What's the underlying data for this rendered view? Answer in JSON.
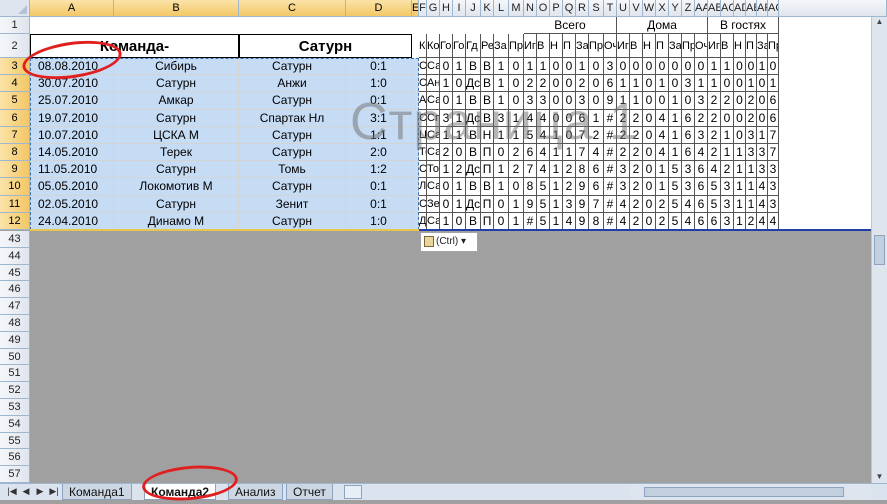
{
  "columns": [
    "A",
    "B",
    "C",
    "D",
    "E",
    "F",
    "G",
    "H",
    "I",
    "J",
    "K",
    "L",
    "M",
    "N",
    "O",
    "P",
    "Q",
    "R",
    "S",
    "T",
    "U",
    "V",
    "W",
    "X",
    "Y",
    "Z",
    "AA",
    "AB",
    "AC",
    "AD",
    "AE",
    "AF",
    "AG",
    "AH"
  ],
  "left_header": {
    "row_num": "2",
    "team_label": "Команда-",
    "team_value": "Сатурн"
  },
  "right_header": {
    "group_all": "Всего",
    "group_home": "Дома",
    "group_away": "В гостях",
    "sub": [
      "Ко",
      "Ко",
      "Го",
      "Го",
      "Гд",
      "Ре",
      "За",
      "Пр",
      "Иг",
      "В",
      "Н",
      "П",
      "За",
      "Пр",
      "Оч",
      "Иг",
      "В",
      "Н",
      "П",
      "За",
      "Пр",
      "Оч",
      "Иг",
      "В",
      "Н",
      "П",
      "За",
      "Пр"
    ]
  },
  "rows": [
    {
      "n": "3",
      "date": "08.08.2010",
      "home": "Сибирь",
      "away": "Сатурн",
      "score": "0:1"
    },
    {
      "n": "4",
      "date": "30.07.2010",
      "home": "Сатурн",
      "away": "Анжи",
      "score": "1:0"
    },
    {
      "n": "5",
      "date": "25.07.2010",
      "home": "Амкар",
      "away": "Сатурн",
      "score": "0:1"
    },
    {
      "n": "6",
      "date": "19.07.2010",
      "home": "Сатурн",
      "away": "Спартак Нл",
      "score": "3:1"
    },
    {
      "n": "7",
      "date": "10.07.2010",
      "home": "ЦСКА М",
      "away": "Сатурн",
      "score": "1:1"
    },
    {
      "n": "8",
      "date": "14.05.2010",
      "home": "Терек",
      "away": "Сатурн",
      "score": "2:0"
    },
    {
      "n": "9",
      "date": "11.05.2010",
      "home": "Сатурн",
      "away": "Томь",
      "score": "1:2"
    },
    {
      "n": "10",
      "date": "05.05.2010",
      "home": "Локомотив М",
      "away": "Сатурн",
      "score": "0:1"
    },
    {
      "n": "11",
      "date": "02.05.2010",
      "home": "Сатурн",
      "away": "Зенит",
      "score": "0:1"
    },
    {
      "n": "12",
      "date": "24.04.2010",
      "home": "Динамо М",
      "away": "Сатурн",
      "score": "1:0"
    }
  ],
  "stats": [
    [
      "Си",
      "Са",
      "0",
      "1",
      "В",
      "В",
      "1",
      "0",
      "1",
      "1",
      "0",
      "0",
      "1",
      "0",
      "3",
      "0",
      "0",
      "0",
      "0",
      "0",
      "0",
      "0",
      "1",
      "1",
      "0",
      "0",
      "1",
      "0"
    ],
    [
      "Са",
      "Ан",
      "1",
      "0",
      "Дс",
      "В",
      "1",
      "0",
      "2",
      "2",
      "0",
      "0",
      "2",
      "0",
      "6",
      "1",
      "1",
      "0",
      "1",
      "0",
      "3",
      "1",
      "1",
      "0",
      "0",
      "1",
      "0",
      "1"
    ],
    [
      "Ам",
      "Са",
      "0",
      "1",
      "В",
      "В",
      "1",
      "0",
      "3",
      "3",
      "0",
      "0",
      "3",
      "0",
      "9",
      "1",
      "1",
      "0",
      "0",
      "1",
      "0",
      "3",
      "2",
      "2",
      "0",
      "2",
      "0",
      "6"
    ],
    [
      "Са",
      "Сп",
      "3",
      "1",
      "Дс",
      "В",
      "3",
      "1",
      "4",
      "4",
      "0",
      "0",
      "6",
      "1",
      "#",
      "2",
      "2",
      "0",
      "4",
      "1",
      "6",
      "2",
      "2",
      "0",
      "0",
      "2",
      "0",
      "6"
    ],
    [
      "Цс",
      "Са",
      "1",
      "1",
      "В",
      "Н",
      "1",
      "1",
      "5",
      "4",
      "1",
      "0",
      "7",
      "2",
      "#",
      "2",
      "2",
      "0",
      "4",
      "1",
      "6",
      "3",
      "2",
      "1",
      "0",
      "3",
      "1",
      "7"
    ],
    [
      "Те",
      "Са",
      "2",
      "0",
      "В",
      "П",
      "0",
      "2",
      "6",
      "4",
      "1",
      "1",
      "7",
      "4",
      "#",
      "2",
      "2",
      "0",
      "4",
      "1",
      "6",
      "4",
      "2",
      "1",
      "1",
      "3",
      "3",
      "7"
    ],
    [
      "Са",
      "То",
      "1",
      "2",
      "Дс",
      "П",
      "1",
      "2",
      "7",
      "4",
      "1",
      "2",
      "8",
      "6",
      "#",
      "3",
      "2",
      "0",
      "1",
      "5",
      "3",
      "6",
      "4",
      "2",
      "1",
      "1",
      "3",
      "3"
    ],
    [
      "Ло",
      "Са",
      "0",
      "1",
      "В",
      "В",
      "1",
      "0",
      "8",
      "5",
      "1",
      "2",
      "9",
      "6",
      "#",
      "3",
      "2",
      "0",
      "1",
      "5",
      "3",
      "6",
      "5",
      "3",
      "1",
      "1",
      "4",
      "3"
    ],
    [
      "Са",
      "Зе",
      "0",
      "1",
      "Дс",
      "П",
      "0",
      "1",
      "9",
      "5",
      "1",
      "3",
      "9",
      "7",
      "#",
      "4",
      "2",
      "0",
      "2",
      "5",
      "4",
      "6",
      "5",
      "3",
      "1",
      "1",
      "4",
      "3"
    ],
    [
      "Ди",
      "Са",
      "1",
      "0",
      "В",
      "П",
      "0",
      "1",
      "#",
      "5",
      "1",
      "4",
      "9",
      "8",
      "#",
      "4",
      "2",
      "0",
      "2",
      "5",
      "4",
      "6",
      "6",
      "3",
      "1",
      "2",
      "4",
      "4"
    ]
  ],
  "lower_rows": [
    "43",
    "44",
    "45",
    "46",
    "47",
    "48",
    "49",
    "50",
    "51",
    "52",
    "53",
    "54",
    "55",
    "56",
    "57"
  ],
  "watermark": "Страница 1",
  "paste_options": "(Ctrl)",
  "sheet_tabs": [
    {
      "label": "Команда1",
      "active": false
    },
    {
      "label": "Команда2",
      "active": true
    },
    {
      "label": "Анализ",
      "active": false
    },
    {
      "label": "Отчет",
      "active": false
    }
  ],
  "colors": {
    "selection": "#c6dcf5",
    "annotation": "#e02020",
    "grid_dark": "#555555"
  }
}
